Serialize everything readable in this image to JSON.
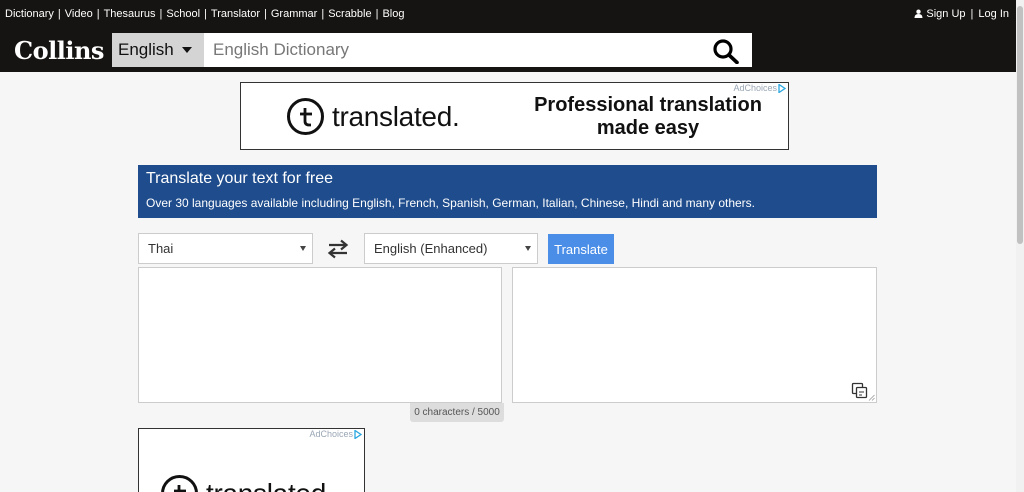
{
  "topnav": {
    "links": [
      "Dictionary",
      "Video",
      "Thesaurus",
      "School",
      "Translator",
      "Grammar",
      "Scrabble",
      "Blog"
    ],
    "separator": "|"
  },
  "account": {
    "signup": "Sign Up",
    "login": "Log In",
    "separator": "|"
  },
  "header": {
    "logo": "Collins",
    "language": "English",
    "search_placeholder": "English Dictionary"
  },
  "ad_top": {
    "adchoices": "AdChoices",
    "brand": "translated.",
    "tagline": "Professional translation made easy"
  },
  "translate_panel": {
    "title": "Translate your text for free",
    "subtitle": "Over 30 languages available including English, French, Spanish, German, Italian, Chinese, Hindi and many others."
  },
  "controls": {
    "source_language": "Thai",
    "target_language": "English (Enhanced)",
    "translate_label": "Translate",
    "source_text": "",
    "target_text": "",
    "char_count": "0 characters / 5000"
  },
  "ad_bottom": {
    "adchoices": "AdChoices",
    "brand": "translated."
  },
  "icons": {
    "user": "user-icon",
    "search": "search-icon",
    "swap": "swap-arrows-icon",
    "copy": "copy-icon",
    "adchoices": "adchoices-icon"
  },
  "colors": {
    "header_bg": "#161412",
    "panel_blue": "#1e4c8c",
    "button_blue": "#4a8ee8",
    "page_bg": "#f6f6f6"
  }
}
